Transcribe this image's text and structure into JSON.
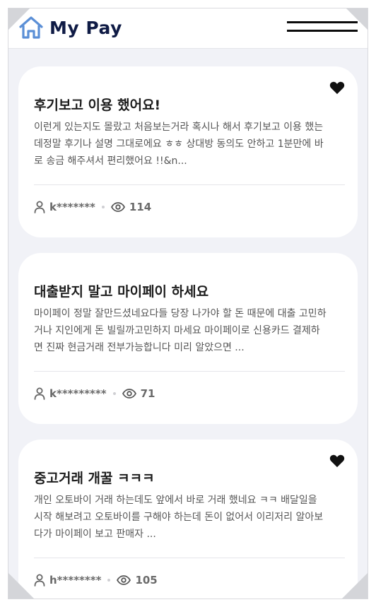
{
  "header": {
    "logo_text": "My Pay",
    "home_icon": "home-icon",
    "menu_icon": "hamburger-menu-icon"
  },
  "posts": [
    {
      "title": "후기보고 이용 했어요!",
      "body_lines": [
        "이런게 있는지도 몰랐고 처음보는거라 혹시나 해서 후기보고 이용 했는",
        "데정말 후기나 설명 그대로에요 ㅎㅎ 상대방 동의도 안하고 1분만에 바",
        "로 송금 해주셔서 편리했어요 !!&n..."
      ],
      "author": "k*******",
      "views": "114",
      "liked": true
    },
    {
      "title": "대출받지 말고 마이페이 하세요",
      "body_lines": [
        "마이페이 정말 잘만드셨네요다들 당장 나가야 할 돈 때문에 대출 고민하",
        "거나 지인에게 돈 빌릴까고민하지 마세요 마이페이로 신용카드 결제하",
        "면 진짜 현금거래 전부가능합니다 미리 알았으면 ..."
      ],
      "author": "k*********",
      "views": "71",
      "liked": false
    },
    {
      "title": "중고거래 개꿀 ㅋㅋㅋ",
      "body_lines": [
        "개인 오토바이 거래 하는데도 앞에서 바로 거래 했네요 ㅋㅋ 배달일을",
        "시작 해보려고 오토바이를 구해야 하는데 돈이 없어서 이리저리 알아보",
        "다가 마이페이 보고 판매자 ..."
      ],
      "author": "h********",
      "views": "105",
      "liked": true
    }
  ],
  "colors": {
    "brand_navy": "#0f1b45",
    "logo_blue": "#5b8fd6",
    "background": "#f1f2f7"
  }
}
